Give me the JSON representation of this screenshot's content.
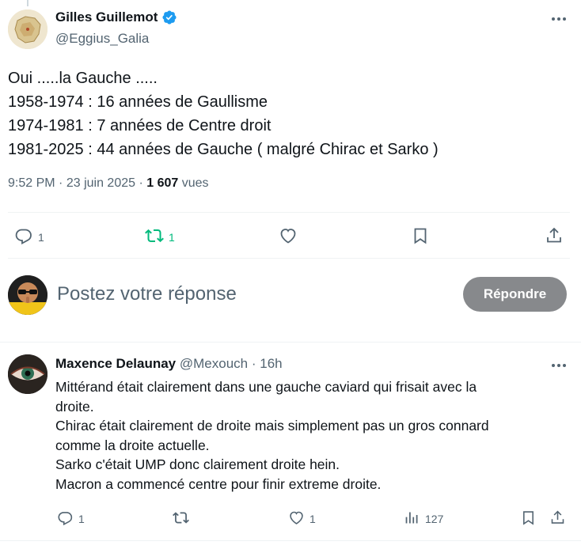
{
  "main_tweet": {
    "author_name": "Gilles Guillemot",
    "author_handle": "@Eggius_Galia",
    "text_lines": [
      "Oui .....la Gauche .....",
      "1958-1974 : 16 années de Gaullisme",
      "1974-1981 : 7 années de Centre droit",
      "1981-2025 : 44 années de Gauche ( malgré Chirac et Sarko )"
    ],
    "time": "9:52 PM",
    "separator": "·",
    "date": "23 juin 2025",
    "views_count": "1 607",
    "views_label": "vues",
    "actions": {
      "reply_count": "1",
      "repost_count": "1",
      "like_count": "",
      "bookmark_count": ""
    }
  },
  "composer": {
    "placeholder": "Postez votre réponse",
    "button_label": "Répondre"
  },
  "reply_tweet": {
    "author_name": "Maxence Delaunay",
    "author_handle": "@Mexouch",
    "separator": "·",
    "age": "16h",
    "text_lines": [
      "Mittérand était clairement dans une gauche caviard qui frisait avec la",
      "droite.",
      "Chirac était clairement de droite mais simplement pas un gros connard",
      "comme la droite actuelle.",
      "Sarko c'était UMP donc clairement droite hein.",
      "Macron a commencé centre pour finir extreme droite."
    ],
    "actions": {
      "reply_count": "1",
      "repost_count": "",
      "like_count": "1",
      "views_count": "127"
    }
  },
  "colors": {
    "text": "#0f1419",
    "secondary": "#536471",
    "verified": "#1d9bf0",
    "repost_active": "#00ba7c",
    "button_disabled": "#87898c",
    "divider": "#eff3f4"
  },
  "icons": [
    "verified-badge-icon",
    "more-icon",
    "reply-icon",
    "repost-icon",
    "like-icon",
    "bookmark-icon",
    "share-icon",
    "views-icon"
  ]
}
